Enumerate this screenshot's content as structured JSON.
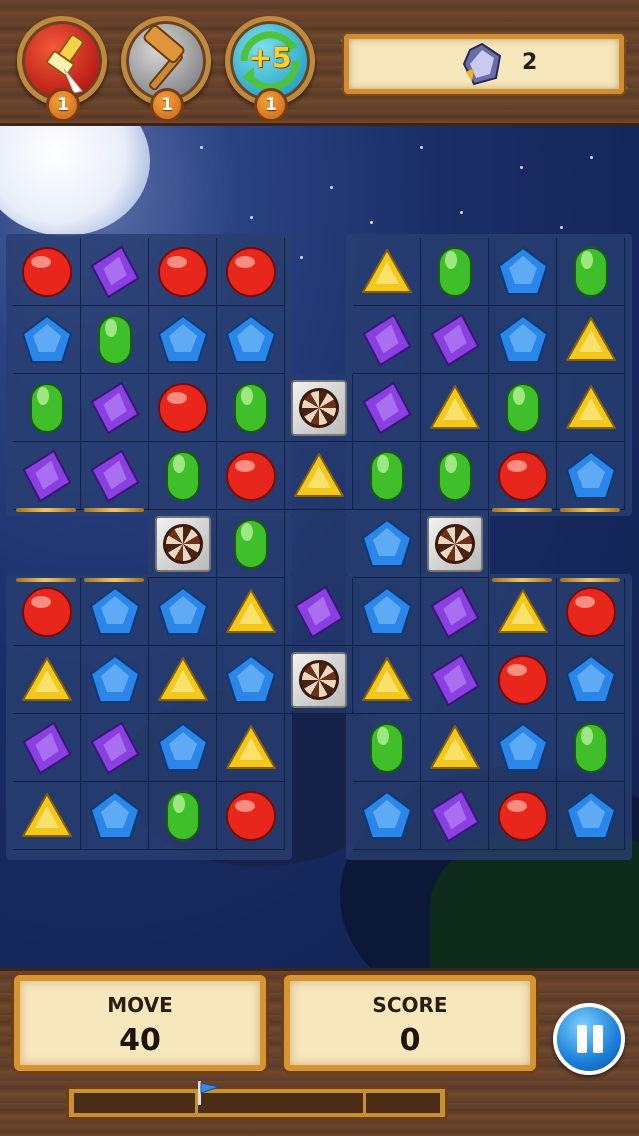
{
  "boosters": [
    {
      "name": "brush-booster",
      "count": "1"
    },
    {
      "name": "hammer-booster",
      "count": "1"
    },
    {
      "name": "plus-moves-booster",
      "count": "1",
      "text": "+5"
    }
  ],
  "goal": {
    "icon": "crystal-goal-icon",
    "count": "2"
  },
  "stats": {
    "move_label": "MOVE",
    "move_value": "40",
    "score_label": "SCORE",
    "score_value": "0"
  },
  "progress": {
    "value": 0.33
  },
  "colors": {
    "red": "#e8261c",
    "blue": "#2a86e8",
    "green": "#3fbf2a",
    "purple": "#8a3fe0",
    "yellow": "#f2c81c"
  },
  "grid": [
    [
      "R",
      "P",
      "R",
      "R",
      "-",
      "Y",
      "G",
      "B",
      "G"
    ],
    [
      "B",
      "G",
      "B",
      "B",
      "-",
      "P",
      "P",
      "B",
      "Y"
    ],
    [
      "G",
      "P",
      "R",
      "G",
      "X",
      "P",
      "Y",
      "G",
      "Y"
    ],
    [
      "P",
      "P",
      "G",
      "R",
      "Y",
      "G",
      "G",
      "R",
      "B"
    ],
    [
      "-",
      "-",
      "X",
      "G",
      "-",
      "B",
      "X",
      "-",
      "-"
    ],
    [
      "R",
      "B",
      "B",
      "Y",
      "P",
      "B",
      "P",
      "Y",
      "R"
    ],
    [
      "Y",
      "B",
      "Y",
      "B",
      "X",
      "Y",
      "P",
      "R",
      "B"
    ],
    [
      "P",
      "P",
      "B",
      "Y",
      "-",
      "G",
      "Y",
      "B",
      "G"
    ],
    [
      "Y",
      "B",
      "G",
      "R",
      "-",
      "B",
      "P",
      "R",
      "B"
    ]
  ]
}
